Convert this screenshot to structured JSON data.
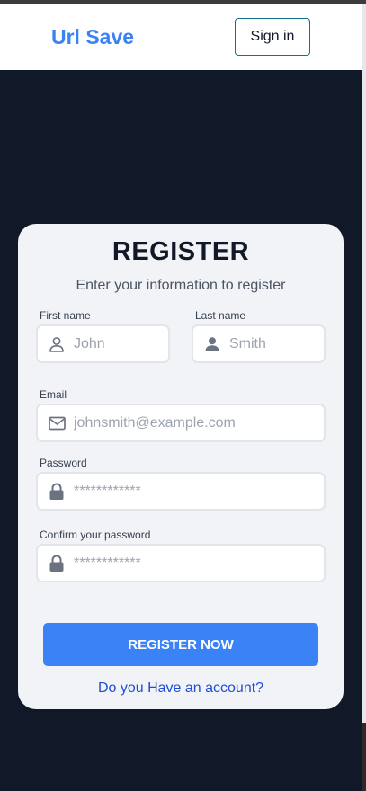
{
  "navbar": {
    "brand": "Url Save",
    "signin_label": "Sign in"
  },
  "form": {
    "title": "REGISTER",
    "subtitle": "Enter your information to register",
    "first_name": {
      "label": "First name",
      "placeholder": "John",
      "icon": "user-outline-icon"
    },
    "last_name": {
      "label": "Last name",
      "placeholder": "Smith",
      "icon": "user-solid-icon"
    },
    "email": {
      "label": "Email",
      "placeholder": "johnsmith@example.com",
      "icon": "envelope-icon"
    },
    "password": {
      "label": "Password",
      "placeholder": "************",
      "icon": "lock-icon"
    },
    "confirm_password": {
      "label": "Confirm your password",
      "placeholder": "************",
      "icon": "lock-icon"
    },
    "submit_label": "REGISTER NOW",
    "login_link": "Do you Have an account?"
  },
  "colors": {
    "background": "#111827",
    "accent": "#3b82f6",
    "card": "#f1f3f6"
  }
}
